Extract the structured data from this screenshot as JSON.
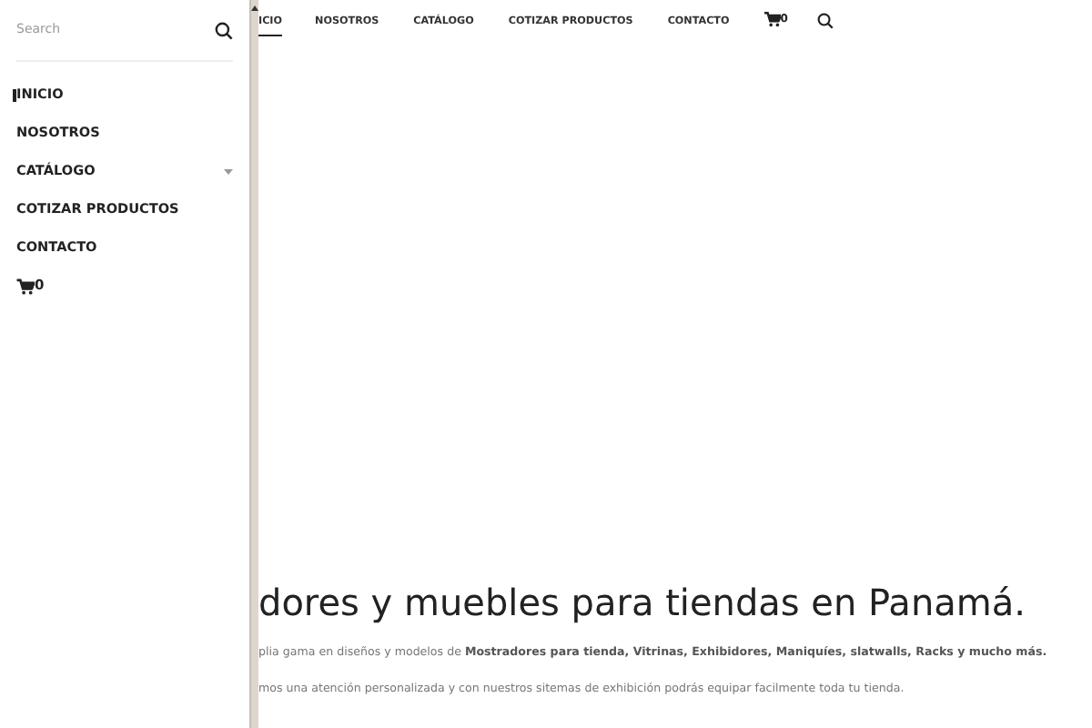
{
  "sidebar": {
    "search": {
      "placeholder": "Search"
    },
    "items": [
      {
        "label": "INICIO",
        "selected": true,
        "expandable": false
      },
      {
        "label": "NOSOTROS",
        "selected": false,
        "expandable": false
      },
      {
        "label": "CATÁLOGO",
        "selected": false,
        "expandable": true
      },
      {
        "label": "COTIZAR PRODUCTOS",
        "selected": false,
        "expandable": false
      },
      {
        "label": "CONTACTO",
        "selected": false,
        "expandable": false
      }
    ],
    "cart_count": "0"
  },
  "navbar": {
    "items": [
      {
        "label": "ICIO",
        "selected": true
      },
      {
        "label": "NOSOTROS",
        "selected": false
      },
      {
        "label": "CATÁLOGO",
        "selected": false
      },
      {
        "label": "COTIZAR PRODUCTOS",
        "selected": false
      },
      {
        "label": "CONTACTO",
        "selected": false
      }
    ],
    "cart_count": "0"
  },
  "hero": {
    "heading": "dores y muebles para tiendas en Panamá.",
    "paragraphs": [
      "plia gama en diseños y modelos de **Mostradores para tienda, Vitrinas, Exhibidores, Maniquíes, slatwalls,  Racks y mucho más.**",
      "mos una atención personalizada y con nuestros sitemas de exhibición podrás equipar facilmente toda tu tienda."
    ]
  }
}
